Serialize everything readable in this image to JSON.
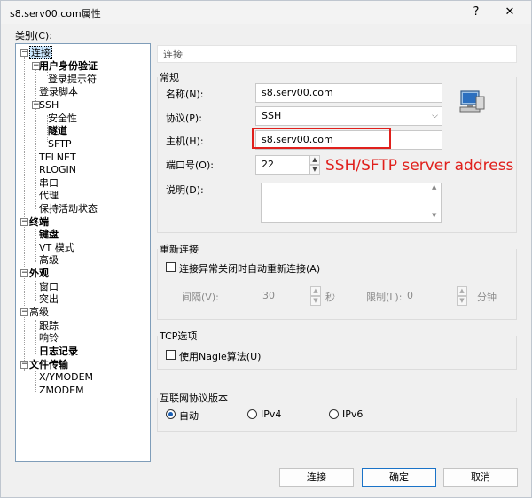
{
  "window": {
    "title": "s8.serv00.com属性",
    "help_glyph": "?",
    "close_glyph": "✕"
  },
  "category_label": "类别(C):",
  "tree": {
    "items": [
      {
        "label": "连接"
      },
      {
        "label": "用户身份验证"
      },
      {
        "label": "登录提示符"
      },
      {
        "label": "登录脚本"
      },
      {
        "label": "SSH"
      },
      {
        "label": "安全性"
      },
      {
        "label": "隧道"
      },
      {
        "label": "SFTP"
      },
      {
        "label": "TELNET"
      },
      {
        "label": "RLOGIN"
      },
      {
        "label": "串口"
      },
      {
        "label": "代理"
      },
      {
        "label": "保持活动状态"
      },
      {
        "label": "终端"
      },
      {
        "label": "键盘"
      },
      {
        "label": "VT 模式"
      },
      {
        "label": "高级"
      },
      {
        "label": "外观"
      },
      {
        "label": "窗口"
      },
      {
        "label": "突出"
      },
      {
        "label": "高级"
      },
      {
        "label": "跟踪"
      },
      {
        "label": "响铃"
      },
      {
        "label": "日志记录"
      },
      {
        "label": "文件传输"
      },
      {
        "label": "X/YMODEM"
      },
      {
        "label": "ZMODEM"
      }
    ]
  },
  "panel": {
    "header": "连接",
    "general_title": "常规",
    "name_label": "名称(N):",
    "name_value": "s8.serv00.com",
    "protocol_label": "协议(P):",
    "protocol_value": "SSH",
    "host_label": "主机(H):",
    "host_value": "s8.serv00.com",
    "port_label": "端口号(O):",
    "port_value": "22",
    "desc_label": "说明(D):",
    "desc_value": ""
  },
  "annotation": "SSH/SFTP server address",
  "reconnect": {
    "title": "重新连接",
    "checkbox_label": "连接异常关闭时自动重新连接(A)",
    "interval_label": "间隔(V):",
    "interval_value": "30",
    "interval_unit": "秒",
    "limit_label": "限制(L):",
    "limit_value": "0",
    "limit_unit": "分钟"
  },
  "tcp": {
    "title": "TCP选项",
    "nagle_label": "使用Nagle算法(U)"
  },
  "ip": {
    "title": "互联网协议版本",
    "opt_auto": "自动",
    "opt_ipv4": "IPv4",
    "opt_ipv6": "IPv6"
  },
  "buttons": {
    "connect": "连接",
    "ok": "确定",
    "cancel": "取消"
  },
  "colors": {
    "annotation_red": "#e0201c",
    "selection_blue": "#cce8ff",
    "accent_blue": "#1a73c8"
  }
}
